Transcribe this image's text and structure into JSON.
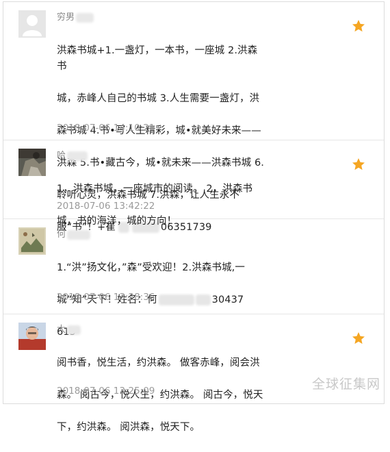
{
  "accent": {
    "star": "#f5a623",
    "timestamp": "#9a9a9a",
    "username": "#888888"
  },
  "comments": [
    {
      "username": "穷男",
      "avatar": "default-avatar-icon",
      "text_line1": "洪森书城+1.一盏灯，一本书，一座城 2.洪森书",
      "text_line2": "城，赤峰人自己的书城 3.人生需要一盏灯，洪",
      "text_line3": "森书城 4.书•写人生精彩，城•就美好未来——",
      "text_line4": "洪森 5.书•藏古今，城•就未来——洪森书城 6.",
      "text_line5": "聆听心灵，洪森书城 7.洪森，让人生永不",
      "text_line6_a": "服“书”！+崔",
      "text_line6_b": "06351739",
      "timestamp": "2018-07-06 14:10:21",
      "starred": true
    },
    {
      "username": "哈",
      "avatar": "photo-avatar-icon",
      "text_line1": "1，洪森书城，一座城市的阅读。 2，洪森书",
      "text_line2": "城，书的海洋，城的方向！",
      "timestamp": "2018-07-06 13:42:22",
      "starred": true
    },
    {
      "username": "何",
      "avatar": "painting-avatar-icon",
      "text_line1": "1.“洪”扬文化，”森”受欢迎！2.洪森书城,一",
      "text_line2_a": "城”知”天下！姓名：何",
      "text_line2_b": "30437",
      "text_line3": "615",
      "timestamp": "2018-07-06 13:28:36",
      "starred": true
    },
    {
      "username": "大",
      "avatar": "person-avatar-icon",
      "text_line1": "阅书香，悦生活，约洪森。 做客赤峰，阅会洪",
      "text_line2": "森。 阅古今，悦人生，约洪森。 阅古今，悦天",
      "text_line3": "下，约洪森。 阅洪森，悦天下。",
      "timestamp": "2018-07-06 13:25:09",
      "starred": true
    }
  ],
  "watermark": "全球征集网"
}
